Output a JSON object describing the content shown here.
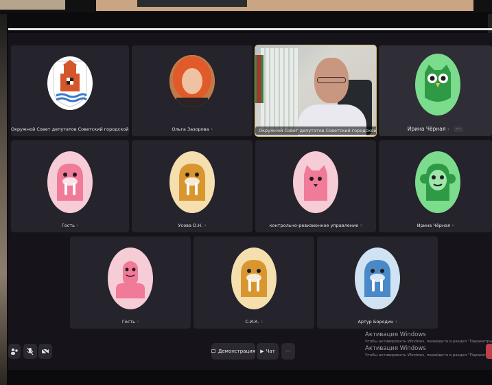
{
  "participants": [
    {
      "name": "Окружной Совет депутатов Советский городской округ",
      "mic": "🎙",
      "avatar": "coat-of-arms",
      "bg": "#ffffff"
    },
    {
      "name": "Ольга Зазорова",
      "mic": "♮",
      "avatar": "photo-woman",
      "bg": "#c98a5a"
    },
    {
      "name": "Окружной Совет депутатов Советский городской окру",
      "mic": "🎙",
      "avatar": "video-man",
      "bg": "#c9c9c9",
      "speaking": true
    },
    {
      "name": "Ирина Чёрная",
      "mic": "♮",
      "more": "···",
      "avatar": "owl",
      "bg": "#7bdc8d",
      "color": "#2f9a45"
    },
    {
      "name": "Гость",
      "mic": "♮",
      "avatar": "walrus",
      "bg": "#f6ccd7",
      "color": "#f07a98"
    },
    {
      "name": "Усова О.Н.",
      "mic": "♮",
      "avatar": "walrus",
      "bg": "#f5dfae",
      "color": "#d9962e"
    },
    {
      "name": "контрольно-ревизионное управление",
      "mic": "♮",
      "avatar": "cat",
      "bg": "#f6ccd7",
      "color": "#f07a98"
    },
    {
      "name": "Ирина Чёрная",
      "mic": "♮",
      "avatar": "monkey",
      "bg": "#7bdc8d",
      "color": "#2f9a45"
    },
    {
      "name": "Гость",
      "mic": "♮",
      "avatar": "turtle",
      "bg": "#f6ccd7",
      "color": "#f07a98"
    },
    {
      "name": "С.И.К.",
      "mic": "♮",
      "avatar": "walrus",
      "bg": "#f5dfae",
      "color": "#d9962e"
    },
    {
      "name": "Артур Бородин",
      "mic": "♮",
      "avatar": "walrus",
      "bg": "#cfe3f3",
      "color": "#4a89c8"
    }
  ],
  "toolbar": {
    "demo_label": "Демонстрация",
    "chat_label": "Чат",
    "more_label": "···"
  },
  "watermark": {
    "title": "Активация Windows",
    "line1": "Чтобы активировать Windows, перейдите в раздел \"Параметры\".",
    "title2": "Активация Windows",
    "line2": "Чтобы активировать Windows, перейдите в раздел \"Параметры\"."
  }
}
